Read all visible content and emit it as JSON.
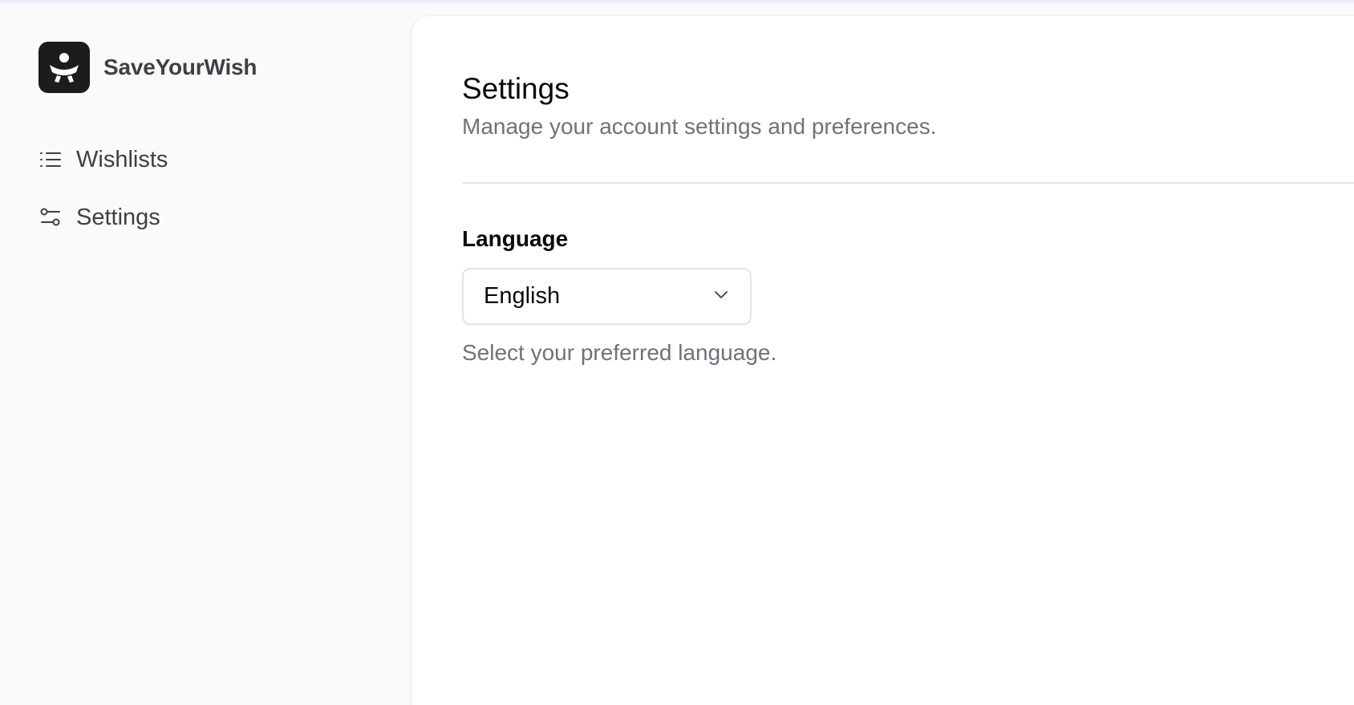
{
  "app": {
    "name": "SaveYourWish",
    "logo_icon": "saveyourwish-logo-icon"
  },
  "sidebar": {
    "items": [
      {
        "label": "Wishlists",
        "icon": "list-icon"
      },
      {
        "label": "Settings",
        "icon": "sliders-icon"
      }
    ]
  },
  "main": {
    "title": "Settings",
    "subtitle": "Manage your account settings and preferences.",
    "language": {
      "label": "Language",
      "selected": "English",
      "helper": "Select your preferred language.",
      "dropdown_icon": "chevron-down-icon"
    }
  },
  "colors": {
    "sidebar_bg": "#fafafa",
    "content_bg": "#ffffff",
    "logo_bg": "#1c1c1c",
    "muted_text": "#71717a",
    "border": "#e4e4e7"
  }
}
